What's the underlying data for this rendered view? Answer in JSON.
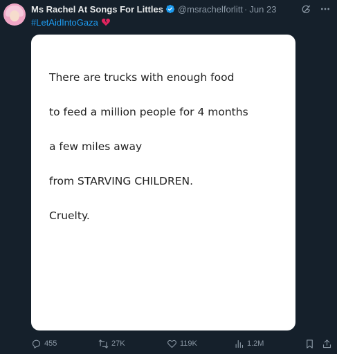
{
  "author": {
    "display_name": "Ms Rachel At Songs For Littles",
    "handle": "@msrachelforlitt",
    "separator": "·",
    "date": "Jun 23",
    "verified": true,
    "avatar": "avatar-photo"
  },
  "tweet": {
    "hashtag": "#LetAidIntoGaza",
    "emoji": "broken-heart-icon"
  },
  "card": {
    "lines": [
      "There are trucks with enough food",
      "to feed a million people for 4 months",
      "a few miles away",
      "from STARVING CHILDREN.",
      "Cruelty."
    ]
  },
  "actions": {
    "replies": "455",
    "retweets": "27K",
    "likes": "119K",
    "views": "1.2M"
  },
  "icons": {
    "reply": "reply-icon",
    "retweet": "retweet-icon",
    "like": "heart-icon",
    "views": "views-icon",
    "bookmark": "bookmark-icon",
    "share": "share-icon",
    "grok": "grok-icon",
    "more": "more-icon"
  },
  "colors": {
    "background": "#15202b",
    "accent": "#1d9bf0",
    "muted": "#8b98a5",
    "card": "#ffffff"
  }
}
